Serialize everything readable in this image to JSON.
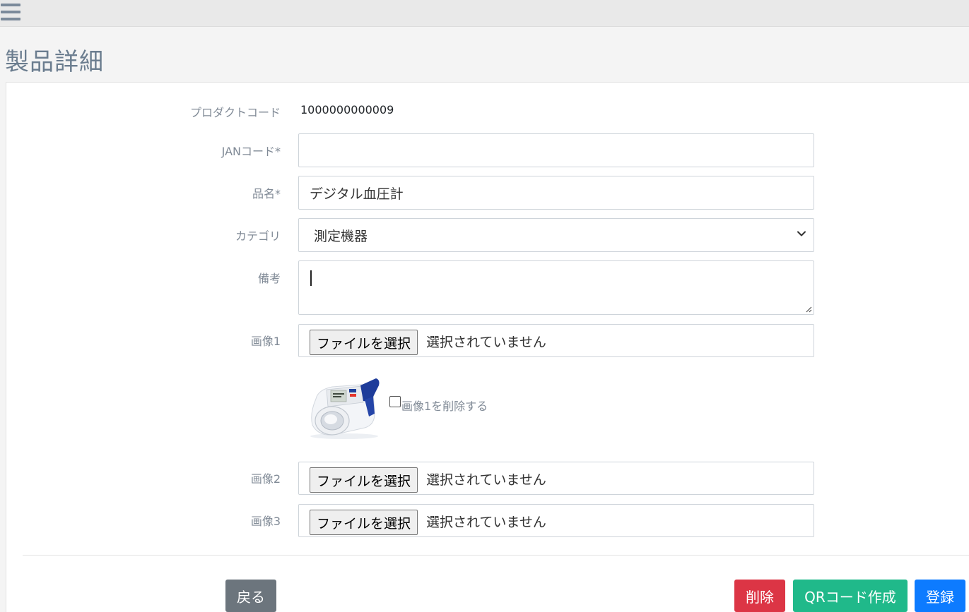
{
  "page": {
    "title": "製品詳細"
  },
  "form": {
    "product_code": {
      "label": "プロダクトコード",
      "value": "1000000000009"
    },
    "jan_code": {
      "label": "JANコード*",
      "value": ""
    },
    "product_name": {
      "label": "品名*",
      "value": "デジタル血圧計"
    },
    "category": {
      "label": "カテゴリ",
      "selected": "測定機器"
    },
    "notes": {
      "label": "備考",
      "value": ""
    },
    "image1": {
      "label": "画像1",
      "button": "ファイルを選択",
      "status": "選択されていません",
      "delete_label": "画像1を削除する"
    },
    "image2": {
      "label": "画像2",
      "button": "ファイルを選択",
      "status": "選択されていません"
    },
    "image3": {
      "label": "画像3",
      "button": "ファイルを選択",
      "status": "選択されていません"
    }
  },
  "actions": {
    "back": "戻る",
    "delete": "削除",
    "qr": "QRコード作成",
    "register": "登録"
  },
  "colors": {
    "back": "#6c757d",
    "delete": "#dc3545",
    "qr": "#20b98a",
    "register": "#0d7bff",
    "label": "#808a96",
    "title": "#6b7d8f"
  },
  "icons": {
    "menu": "hamburger-icon",
    "select": "chevron-down-icon"
  }
}
